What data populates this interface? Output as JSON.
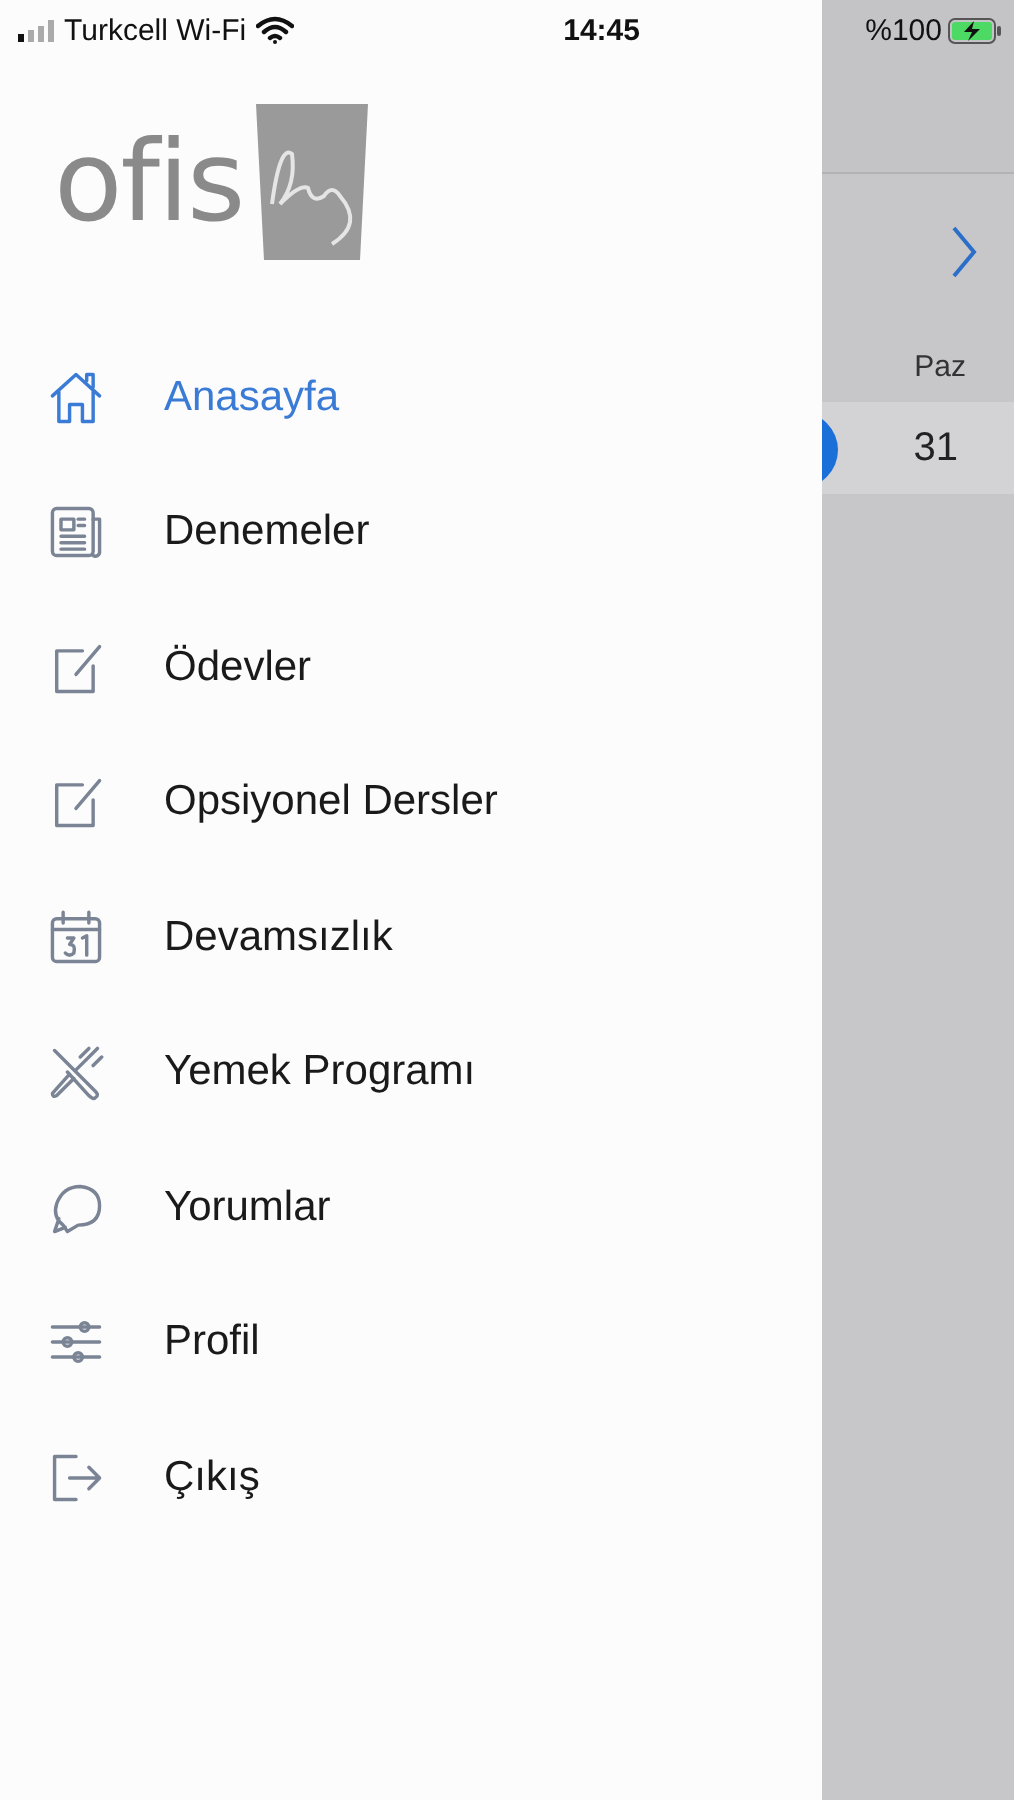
{
  "status_bar": {
    "carrier": "Turkcell Wi-Fi",
    "time": "14:45",
    "battery": "%100",
    "charging": true
  },
  "drawer": {
    "logo": "ofis",
    "items": [
      {
        "label": "Anasayfa",
        "selected": true
      },
      {
        "label": "Denemeler",
        "selected": false
      },
      {
        "label": "Ödevler",
        "selected": false
      },
      {
        "label": "Opsiyonel Dersler",
        "selected": false
      },
      {
        "label": "Devamsızlık",
        "selected": false
      },
      {
        "label": "Yemek Programı",
        "selected": false
      },
      {
        "label": "Yorumlar",
        "selected": false
      },
      {
        "label": "Profil",
        "selected": false
      },
      {
        "label": "Çıkış",
        "selected": false
      }
    ]
  },
  "background": {
    "day_header": "Paz",
    "day": "31"
  }
}
